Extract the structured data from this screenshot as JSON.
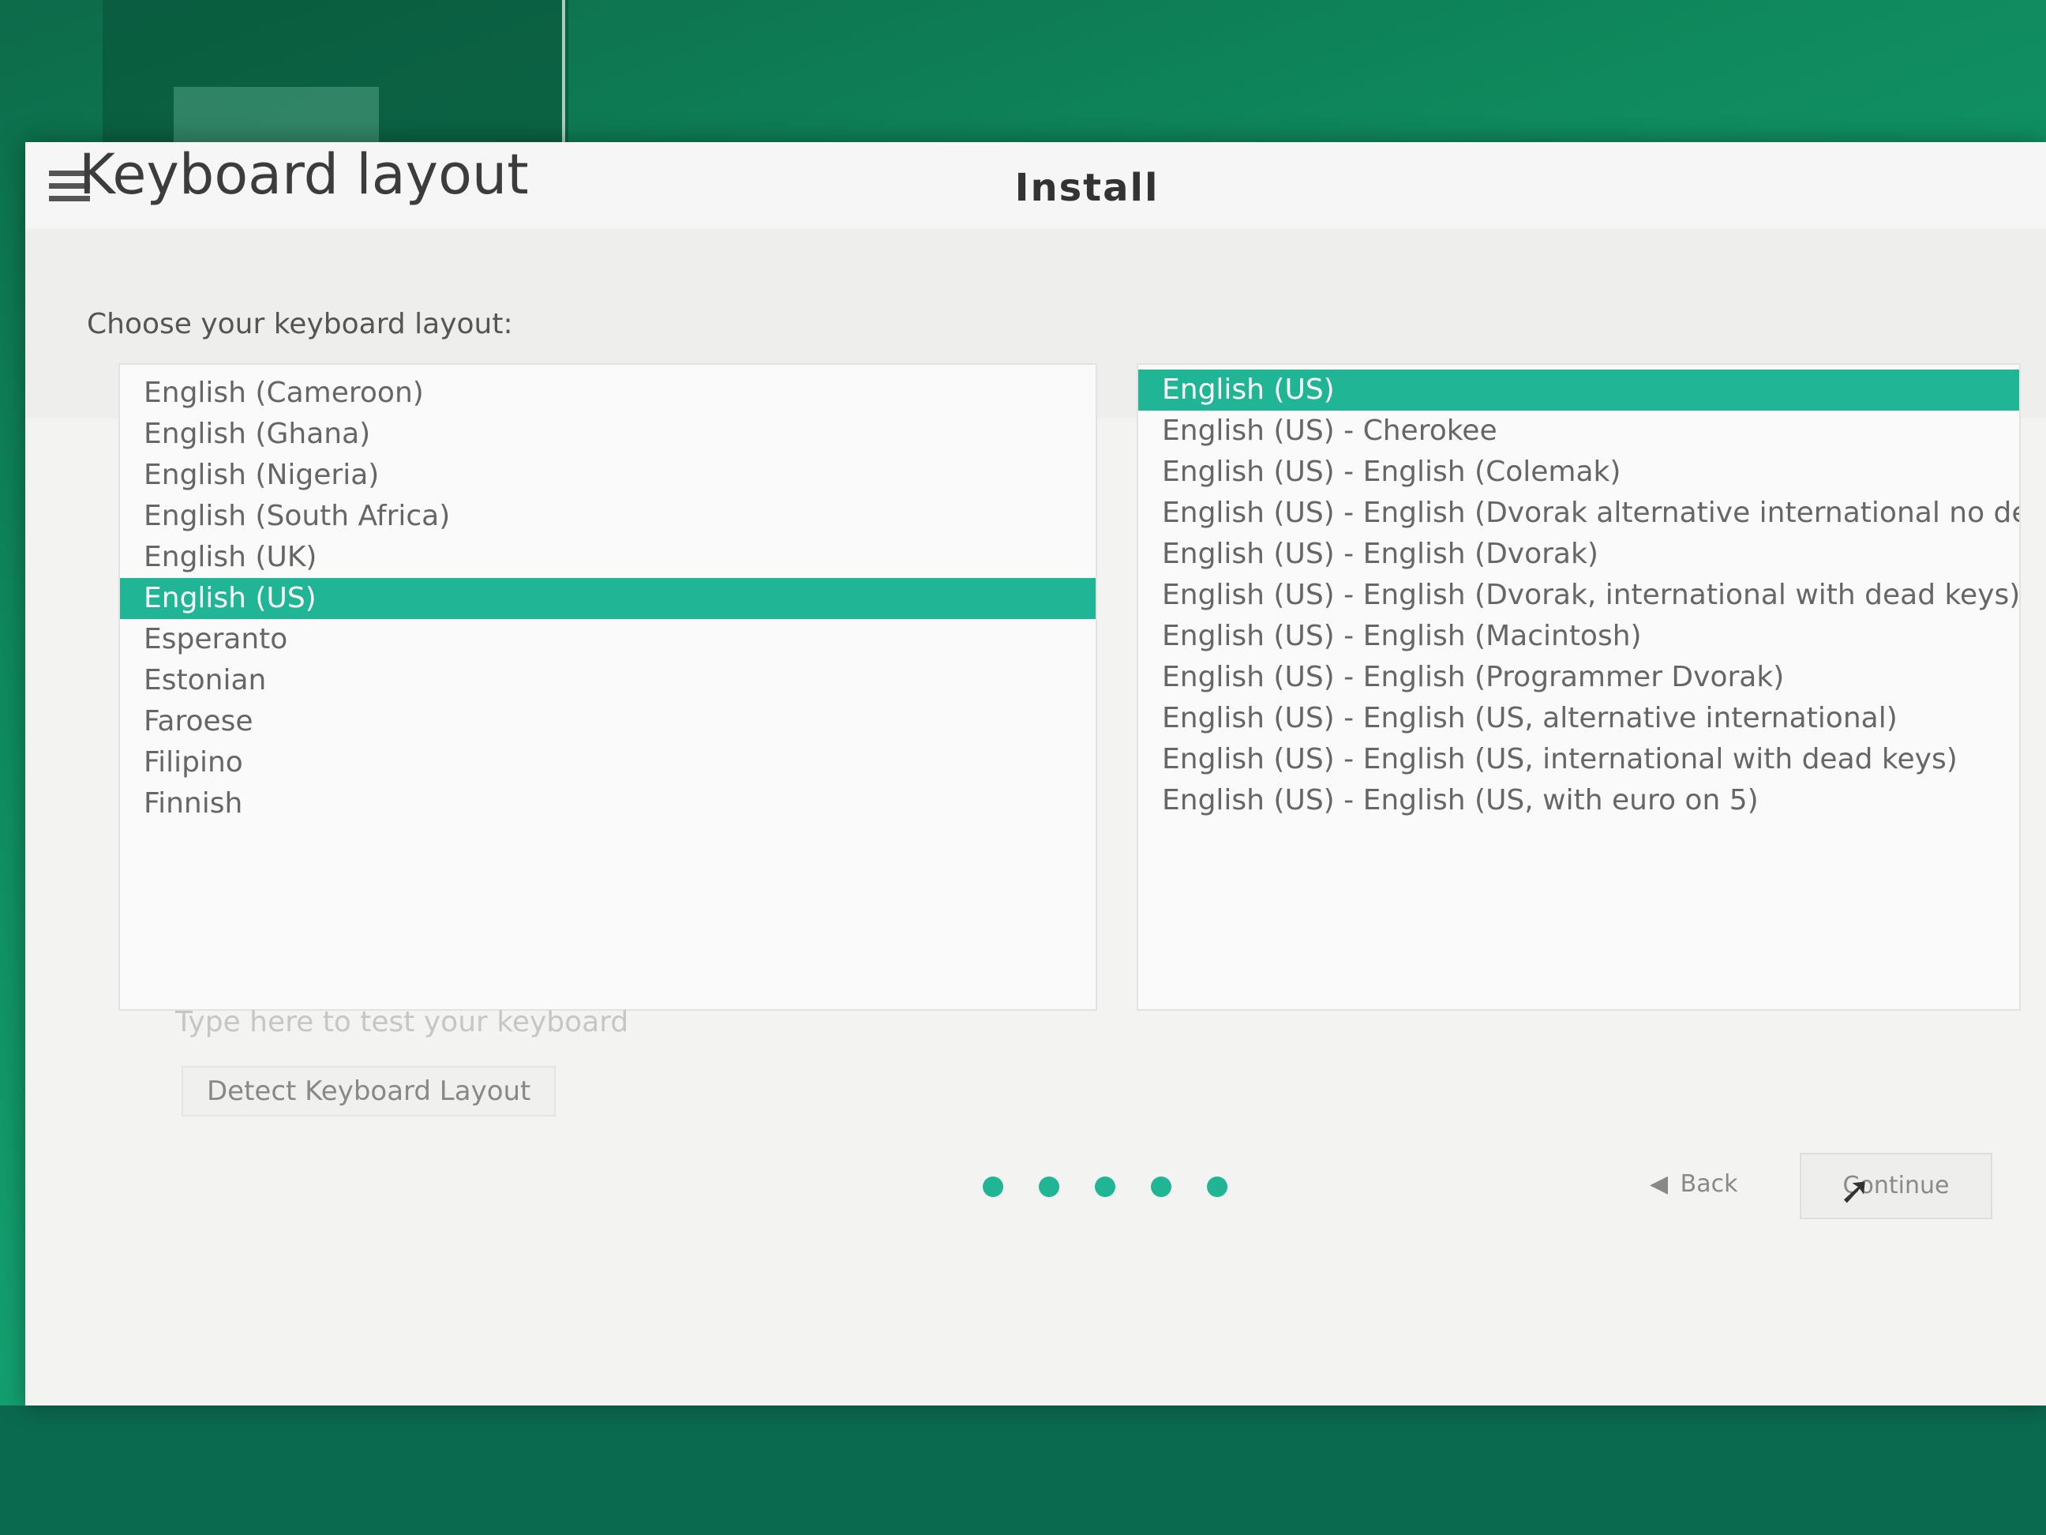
{
  "window": {
    "title": "Install",
    "menu_icon": "hamburger-menu-icon"
  },
  "page": {
    "title": "Keyboard layout",
    "prompt": "Choose your keyboard layout:"
  },
  "layouts": {
    "items": [
      "English (Cameroon)",
      "English (Ghana)",
      "English (Nigeria)",
      "English (South Africa)",
      "English (UK)",
      "English (US)",
      "Esperanto",
      "Estonian",
      "Faroese",
      "Filipino",
      "Finnish"
    ],
    "selected": "English (US)"
  },
  "variants": {
    "items": [
      "English (US)",
      "English (US) - Cherokee",
      "English (US) - English (Colemak)",
      "English (US) - English (Dvorak alternative international no dead keys)",
      "English (US) - English (Dvorak)",
      "English (US) - English (Dvorak, international with dead keys)",
      "English (US) - English (Macintosh)",
      "English (US) - English (Programmer Dvorak)",
      "English (US) - English (US, alternative international)",
      "English (US) - English (US, international with dead keys)",
      "English (US) - English (US, with euro on 5)"
    ],
    "selected": "English (US)"
  },
  "test_field": {
    "placeholder": "Type here to test your keyboard",
    "value": ""
  },
  "buttons": {
    "detect": "Detect Keyboard Layout",
    "back": "Back",
    "continue": "Continue"
  },
  "progress": {
    "steps": 5
  },
  "colors": {
    "accent": "#1fb595",
    "desktop": "#0f8a5e"
  }
}
